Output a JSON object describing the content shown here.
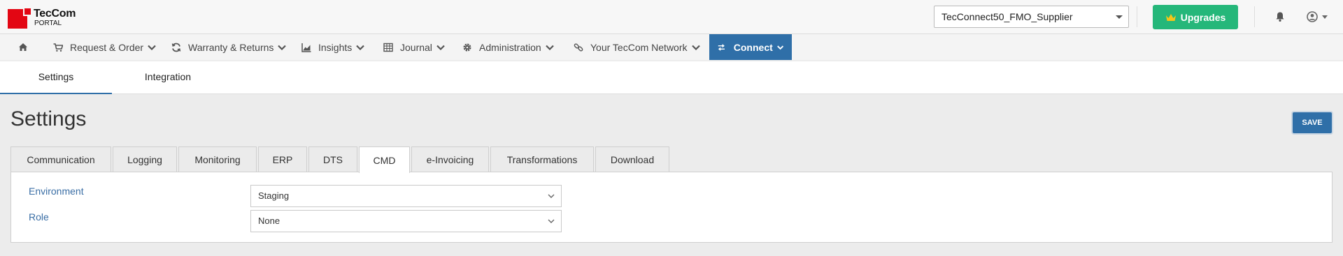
{
  "app": {
    "logo_name": "TecCom",
    "logo_sub": "PORTAL"
  },
  "header": {
    "org_select_value": "TecConnect50_FMO_Supplier",
    "upgrade_label": "Upgrades",
    "upgrade_color": "#25b77a"
  },
  "nav": {
    "items": [
      {
        "label": "Request & Order",
        "icon": "cart-icon"
      },
      {
        "label": "Warranty & Returns",
        "icon": "refresh-icon"
      },
      {
        "label": "Insights",
        "icon": "chart-icon"
      },
      {
        "label": "Journal",
        "icon": "table-icon"
      },
      {
        "label": "Administration",
        "icon": "gear-icon"
      },
      {
        "label": "Your TecCom Network",
        "icon": "link-icon"
      },
      {
        "label": "Connect",
        "icon": "exchange-icon",
        "active": true
      }
    ],
    "accent_color": "#2f6fa8"
  },
  "subtabs": [
    {
      "label": "Settings",
      "active": true
    },
    {
      "label": "Integration"
    }
  ],
  "page": {
    "title": "Settings",
    "save_label": "SAVE"
  },
  "tabs": [
    {
      "label": "Communication"
    },
    {
      "label": "Logging"
    },
    {
      "label": "Monitoring"
    },
    {
      "label": "ERP"
    },
    {
      "label": "DTS"
    },
    {
      "label": "CMD",
      "active": true
    },
    {
      "label": "e-Invoicing"
    },
    {
      "label": "Transformations"
    },
    {
      "label": "Download"
    }
  ],
  "form": {
    "environment": {
      "label": "Environment",
      "value": "Staging"
    },
    "role": {
      "label": "Role",
      "value": "None"
    }
  }
}
